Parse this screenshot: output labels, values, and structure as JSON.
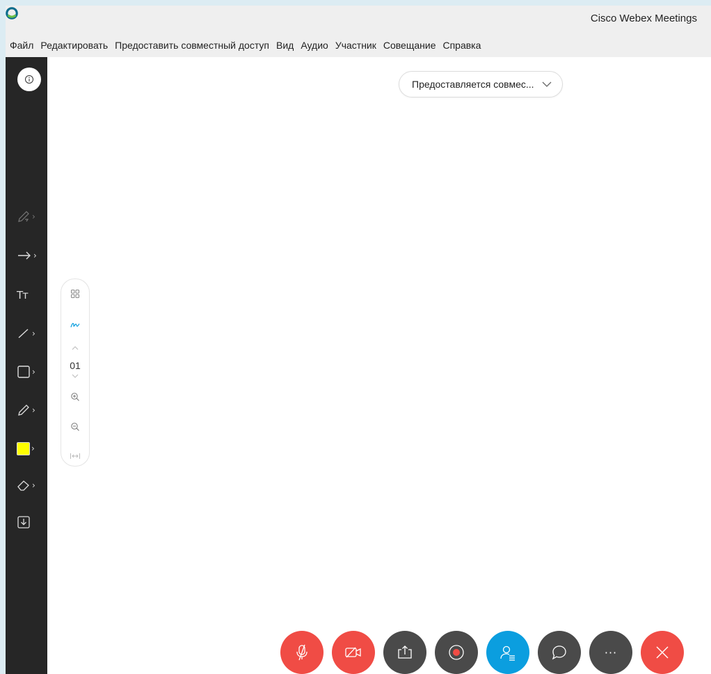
{
  "window": {
    "title": "Cisco Webex Meetings"
  },
  "menu": [
    {
      "id": "file",
      "label": "Файл"
    },
    {
      "id": "edit",
      "label": "Редактировать"
    },
    {
      "id": "share",
      "label": "Предоставить совместный доступ"
    },
    {
      "id": "view",
      "label": "Вид"
    },
    {
      "id": "audio",
      "label": "Аудио"
    },
    {
      "id": "participant",
      "label": "Участник"
    },
    {
      "id": "meeting",
      "label": "Совещание"
    },
    {
      "id": "help",
      "label": "Справка"
    }
  ],
  "sharing_indicator": {
    "label": "Предоставляется совмес..."
  },
  "annotation_tools": {
    "text_tool_glyph": "Tт",
    "active_color": "#ffff00"
  },
  "page_panel": {
    "page_number": "01"
  },
  "controls": {
    "ellipsis": "···"
  },
  "colors": {
    "accent_red": "#f04c45",
    "accent_blue": "#0b9edf",
    "sidebar_bg": "#262626"
  }
}
